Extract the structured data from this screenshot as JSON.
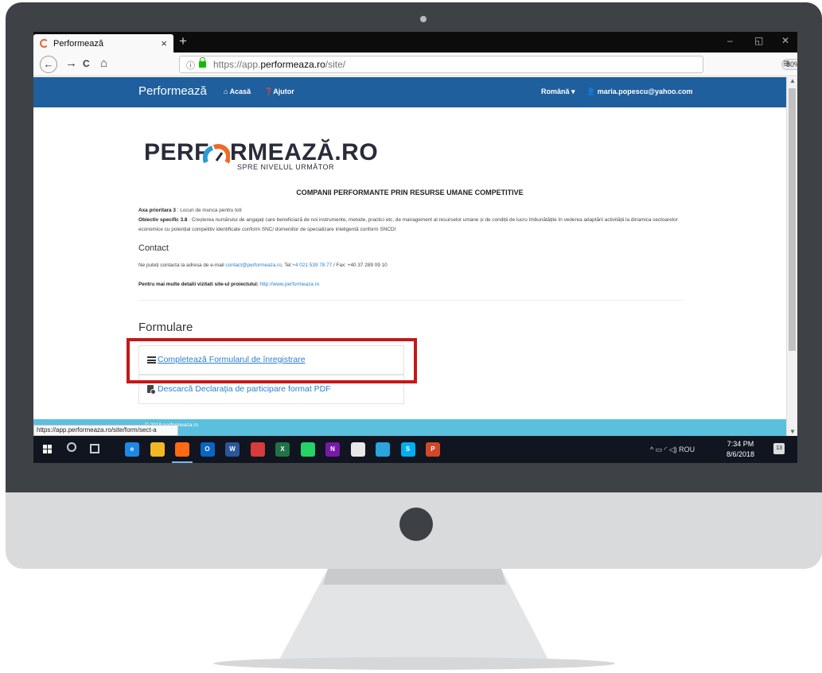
{
  "browser": {
    "tab_title": "Performează",
    "tab_close": "×",
    "new_tab": "+",
    "window_controls": {
      "minimize": "–",
      "restore": "◱",
      "close": "✕"
    },
    "nav": {
      "back": "←",
      "forward": "→",
      "reload": "C",
      "home": "⌂"
    },
    "url_prefix": "https://app.",
    "url_domain": "performeaza.ro",
    "url_path": "/site/",
    "zoom": "80%",
    "more": "···",
    "bookmark": "☆",
    "menu": "≡",
    "status_url": "https://app.performeaza.ro/site/form/sect-a"
  },
  "site_nav": {
    "brand": "Performează",
    "links": [
      {
        "icon": "home-icon",
        "label": "Acasă"
      },
      {
        "icon": "help-icon",
        "label": "Ajutor"
      }
    ],
    "language": "Română",
    "user": "maria.popescu@yahoo.com"
  },
  "logo": {
    "word_left": "PERF",
    "word_right": "RMEAZĂ.RO",
    "tagline": "SPRE NIVELUL URMĂTOR"
  },
  "content": {
    "heading": "COMPANII PERFORMANTE PRIN RESURSE UMANE COMPETITIVE",
    "axa_label": "Axa prioritara 3",
    "axa_text": " : Locuri de munca pentru toti",
    "obiectiv_label": "Obiectiv specific 3.8",
    "obiectiv_text": " : Creșterea numărului de angajați care beneficiază de noi instrumente, metode, practici etc, de management al resurselor umane și de condiții de lucru îmbunătățite în vederea adaptării activității la dinamica sectoarelor economice cu potențial competitiv identificate conform SNC/ domeniilor de specializare inteligentă conform SNCDI",
    "contact_heading": "Contact",
    "contact_text": "Ne puteți contacta la adresa de e-mail ",
    "contact_email": "contact@performeaza.ro",
    "contact_tel_prefix": ", Tel:",
    "contact_tel": "+4 021 539 78 77",
    "contact_fax": " / Fax: +40 37 289 09 10",
    "details_label": "Pentru mai multe detalii vizitati site-ul proiectului:",
    "details_link": " http://www.performeaza.ro"
  },
  "formulare": {
    "heading": "Formulare",
    "items": [
      {
        "icon": "list-icon",
        "label": "Completează Formularul de înregistrare"
      },
      {
        "icon": "pdf-download-icon",
        "label": "Descarcă Declarația de participare format PDF"
      }
    ]
  },
  "footer": {
    "text": "© 2018 performeaza.ro"
  },
  "taskbar": {
    "apps": [
      {
        "name": "edge",
        "label": "e",
        "color": "#1e88e5"
      },
      {
        "name": "file-explorer",
        "label": "",
        "color": "#f2b824"
      },
      {
        "name": "firefox",
        "label": "",
        "color": "#ff6a13"
      },
      {
        "name": "outlook",
        "label": "O",
        "color": "#0a66c2"
      },
      {
        "name": "word",
        "label": "W",
        "color": "#2b579a"
      },
      {
        "name": "security",
        "label": "",
        "color": "#d83b3b"
      },
      {
        "name": "excel",
        "label": "X",
        "color": "#217346"
      },
      {
        "name": "whatsapp",
        "label": "",
        "color": "#25d366"
      },
      {
        "name": "onenote",
        "label": "N",
        "color": "#7719aa"
      },
      {
        "name": "chrome-like",
        "label": "",
        "color": "#e8e8e8"
      },
      {
        "name": "telegram",
        "label": "",
        "color": "#2aa3df"
      },
      {
        "name": "skype",
        "label": "S",
        "color": "#00aff0"
      },
      {
        "name": "powerpoint",
        "label": "P",
        "color": "#d24726"
      }
    ],
    "tray_text": "^  ▭  ◜  ◁)  ROU",
    "time": "7:34 PM",
    "date": "8/6/2018",
    "notifications": "13"
  },
  "colors": {
    "site_nav": "#1f5f9e",
    "footer": "#5bc0de",
    "highlight": "#c41818",
    "link": "#2a7fd0",
    "bezel": "#3e4247"
  }
}
